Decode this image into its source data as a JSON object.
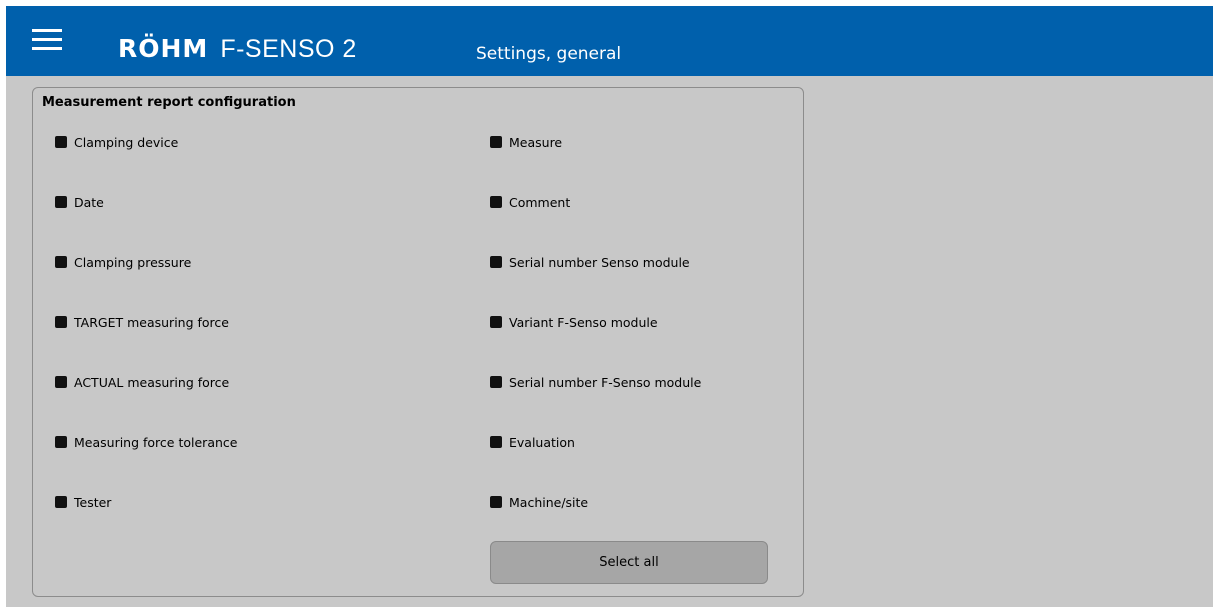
{
  "header": {
    "menu_icon": "hamburger-menu-icon",
    "brand": "RÖHM",
    "product": "F-SENSO 2",
    "title": "Settings, general",
    "background_color": "#0060ac"
  },
  "panel": {
    "title": "Measurement report configuration",
    "left_options": [
      {
        "label": "Clamping device",
        "checked": true
      },
      {
        "label": "Date",
        "checked": true
      },
      {
        "label": "Clamping pressure",
        "checked": true
      },
      {
        "label": "TARGET measuring force",
        "checked": true
      },
      {
        "label": "ACTUAL measuring force",
        "checked": true
      },
      {
        "label": "Measuring force tolerance",
        "checked": true
      },
      {
        "label": "Tester",
        "checked": true
      }
    ],
    "right_options": [
      {
        "label": "Measure",
        "checked": true
      },
      {
        "label": "Comment",
        "checked": true
      },
      {
        "label": "Serial number Senso module",
        "checked": true
      },
      {
        "label": "Variant F-Senso module",
        "checked": true
      },
      {
        "label": "Serial number F-Senso module",
        "checked": true
      },
      {
        "label": "Evaluation",
        "checked": true
      },
      {
        "label": "Machine/site",
        "checked": true
      }
    ],
    "select_all_label": "Select all"
  }
}
